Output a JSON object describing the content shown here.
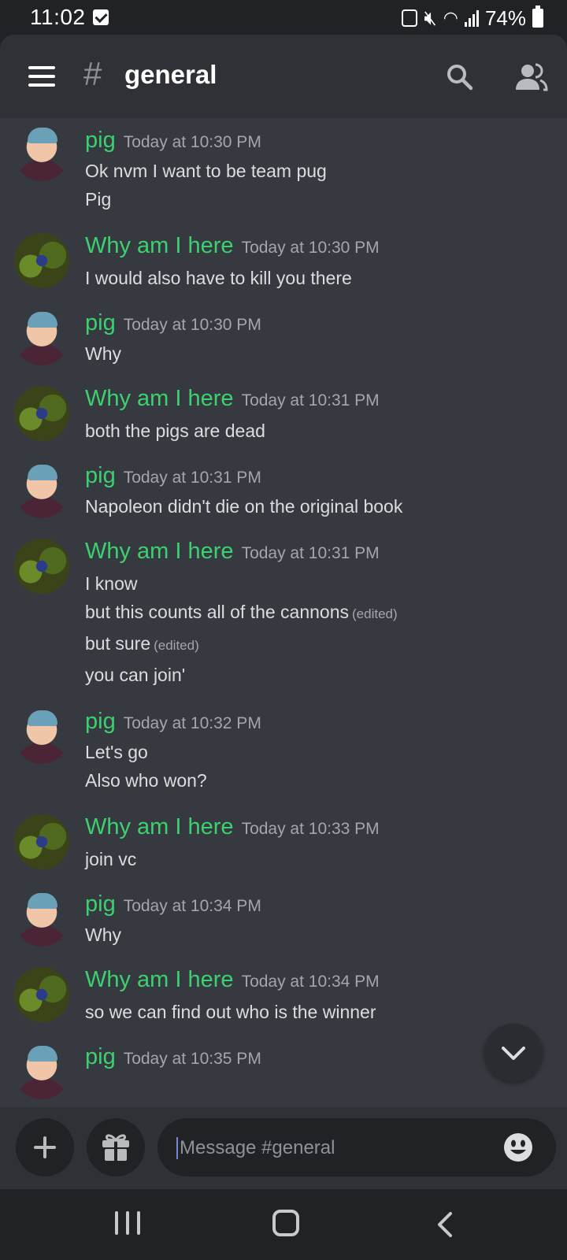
{
  "status_bar": {
    "time": "11:02",
    "battery": "74%"
  },
  "header": {
    "hash": "#",
    "channel_name": "general"
  },
  "messages": [
    {
      "author": "pig",
      "timestamp": "Today at 10:30 PM",
      "avatar": "pig-avatar",
      "lines": [
        {
          "text": "Ok nvm I want to be team pug"
        },
        {
          "text": "Pig"
        }
      ]
    },
    {
      "author": "Why am I here",
      "timestamp": "Today at 10:30 PM",
      "avatar": "bug-avatar",
      "lines": [
        {
          "text": "I would also have to kill you there"
        }
      ]
    },
    {
      "author": "pig",
      "timestamp": "Today at 10:30 PM",
      "avatar": "pig-avatar",
      "lines": [
        {
          "text": "Why"
        }
      ]
    },
    {
      "author": "Why am I here",
      "timestamp": "Today at 10:31 PM",
      "avatar": "bug-avatar",
      "lines": [
        {
          "text": "both the pigs are dead"
        }
      ]
    },
    {
      "author": "pig",
      "timestamp": "Today at 10:31 PM",
      "avatar": "pig-avatar",
      "lines": [
        {
          "text": "Napoleon didn't die on the original book"
        }
      ]
    },
    {
      "author": "Why am I here",
      "timestamp": "Today at 10:31 PM",
      "avatar": "bug-avatar",
      "lines": [
        {
          "text": "I know"
        },
        {
          "text": "but this counts all of the cannons",
          "edited": "(edited)"
        },
        {
          "text": "but sure",
          "edited": "(edited)"
        },
        {
          "text": "you can join'"
        }
      ]
    },
    {
      "author": "pig",
      "timestamp": "Today at 10:32 PM",
      "avatar": "pig-avatar",
      "lines": [
        {
          "text": "Let's go"
        },
        {
          "text": "Also who won?"
        }
      ]
    },
    {
      "author": "Why am I here",
      "timestamp": "Today at 10:33 PM",
      "avatar": "bug-avatar",
      "lines": [
        {
          "text": "join vc"
        }
      ]
    },
    {
      "author": "pig",
      "timestamp": "Today at 10:34 PM",
      "avatar": "pig-avatar",
      "lines": [
        {
          "text": "Why"
        }
      ]
    },
    {
      "author": "Why am I here",
      "timestamp": "Today at 10:34 PM",
      "avatar": "bug-avatar",
      "lines": [
        {
          "text": "so we can find out who is the winner"
        }
      ]
    },
    {
      "author": "pig",
      "timestamp": "Today at 10:35 PM",
      "avatar": "pig-avatar",
      "lines": []
    }
  ],
  "composer": {
    "placeholder": "Message #general"
  },
  "colors": {
    "username": "#3bd16f",
    "chat_bg": "#36393f",
    "header_bg": "#2f3136"
  }
}
